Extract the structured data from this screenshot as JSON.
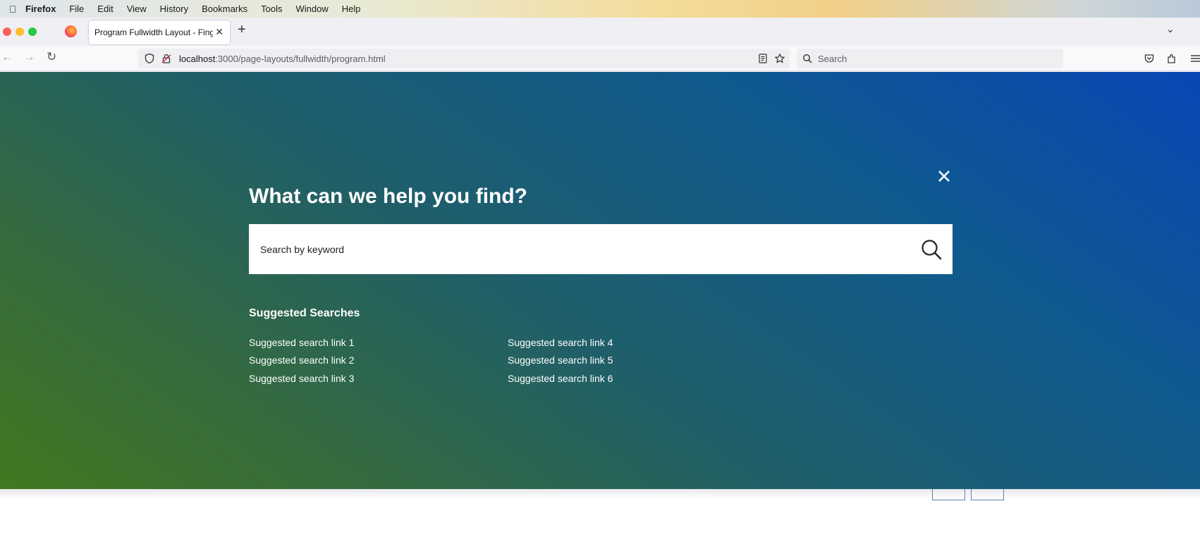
{
  "menubar": {
    "items": [
      "Firefox",
      "File",
      "Edit",
      "View",
      "History",
      "Bookmarks",
      "Tools",
      "Window",
      "Help"
    ]
  },
  "browser": {
    "tab_title": "Program Fullwidth Layout - Finger L",
    "url_host": "localhost",
    "url_path": ":3000/page-layouts/fullwidth/program.html",
    "search_placeholder": "Search"
  },
  "overlay": {
    "heading": "What can we help you find?",
    "search_placeholder": "Search by keyword",
    "suggested_title": "Suggested Searches",
    "links": [
      "Suggested search link 1",
      "Suggested search link 2",
      "Suggested search link 3",
      "Suggested search link 4",
      "Suggested search link 5",
      "Suggested search link 6"
    ]
  },
  "colors": {
    "gradient_start": "#41781f",
    "gradient_end": "#0847b5"
  }
}
